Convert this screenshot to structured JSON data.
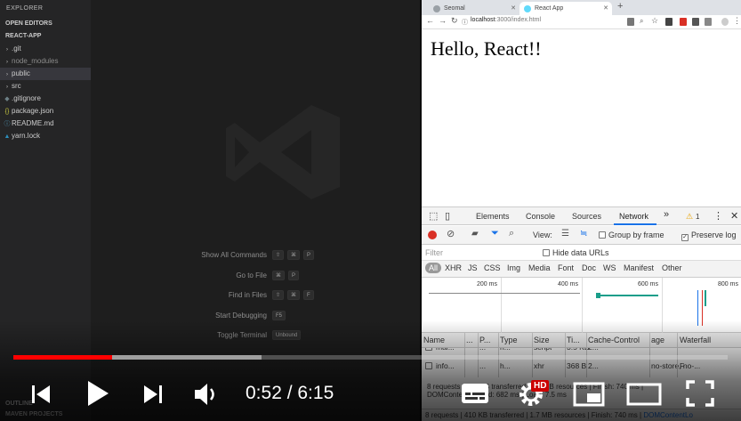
{
  "vscode": {
    "explorer_title": "EXPLORER",
    "open_editors": "OPEN EDITORS",
    "project": "REACT-APP",
    "tree": [
      {
        "label": ".git",
        "type": "folder",
        "dim": false,
        "selected": false
      },
      {
        "label": "node_modules",
        "type": "folder",
        "dim": true,
        "selected": false
      },
      {
        "label": "public",
        "type": "folder",
        "dim": false,
        "selected": true
      },
      {
        "label": "src",
        "type": "folder",
        "dim": false,
        "selected": false
      },
      {
        "label": ".gitignore",
        "type": "gitignore",
        "dim": false,
        "selected": false
      },
      {
        "label": "package.json",
        "type": "json",
        "dim": false,
        "selected": false
      },
      {
        "label": "README.md",
        "type": "md",
        "dim": false,
        "selected": false
      },
      {
        "label": "yarn.lock",
        "type": "lock",
        "dim": false,
        "selected": false
      }
    ],
    "outline": "OUTLINE",
    "maven": "MAVEN PROJECTS",
    "shortcuts": [
      {
        "label": "Show All Commands",
        "keys": [
          "⇧",
          "⌘",
          "P"
        ]
      },
      {
        "label": "Go to File",
        "keys": [
          "⌘",
          "P"
        ]
      },
      {
        "label": "Find in Files",
        "keys": [
          "⇧",
          "⌘",
          "F"
        ]
      },
      {
        "label": "Start Debugging",
        "keys": [
          "F5"
        ]
      },
      {
        "label": "Toggle Terminal",
        "keys": [
          "Unbound"
        ]
      }
    ]
  },
  "browser": {
    "tabs": [
      {
        "label": "Seomal",
        "active": false
      },
      {
        "label": "React App",
        "active": true
      }
    ],
    "url_host": "localhost",
    "url_path": ":3000/index.html",
    "page_heading": "Hello, React!!"
  },
  "devtools": {
    "tabs": [
      "Elements",
      "Console",
      "Sources",
      "Network"
    ],
    "active_tab": "Network",
    "more": "»",
    "warning_count": "1",
    "view_label": "View:",
    "group_by_frame": "Group by frame",
    "preserve_log": "Preserve log",
    "filter_placeholder": "Filter",
    "hide_data_urls": "Hide data URLs",
    "types": [
      "All",
      "XHR",
      "JS",
      "CSS",
      "Img",
      "Media",
      "Font",
      "Doc",
      "WS",
      "Manifest",
      "Other"
    ],
    "ticks": [
      "200 ms",
      "400 ms",
      "600 ms",
      "800 ms"
    ],
    "columns": [
      "Name",
      "...",
      "P...",
      "Type",
      "Size",
      "Ti...",
      "Cache-Control",
      "age",
      "Waterfall"
    ],
    "rows": [
      {
        "name": "mai...",
        "m": "...",
        "p": "h...",
        "type": "script",
        "size": "3.5 KB",
        "time": "2...",
        "cache": "",
        "age": ""
      },
      {
        "name": "info...",
        "m": "...",
        "p": "h...",
        "type": "xhr",
        "size": "368 B",
        "time": "2...",
        "cache": "no-store, no-...",
        "age": "F"
      }
    ],
    "summary_line1": "8 requests | 410 KB transferred | 1.7 MB resources | Finish: 740 ms |",
    "summary_line2": "DOMContentLoaded: 682 ms | Load: 7.5 ms",
    "status": "8 requests | 410 KB transferred | 1.7 MB resources | Finish: 740 ms | ",
    "status_blue": "DOMContentLo"
  },
  "player": {
    "current_time": "0:52",
    "duration": "6:15",
    "time_display": "0:52 / 6:15",
    "played_fraction": 0.138,
    "buffered_fraction": 0.347,
    "hd_label": "HD",
    "accent": "#ff0000"
  }
}
